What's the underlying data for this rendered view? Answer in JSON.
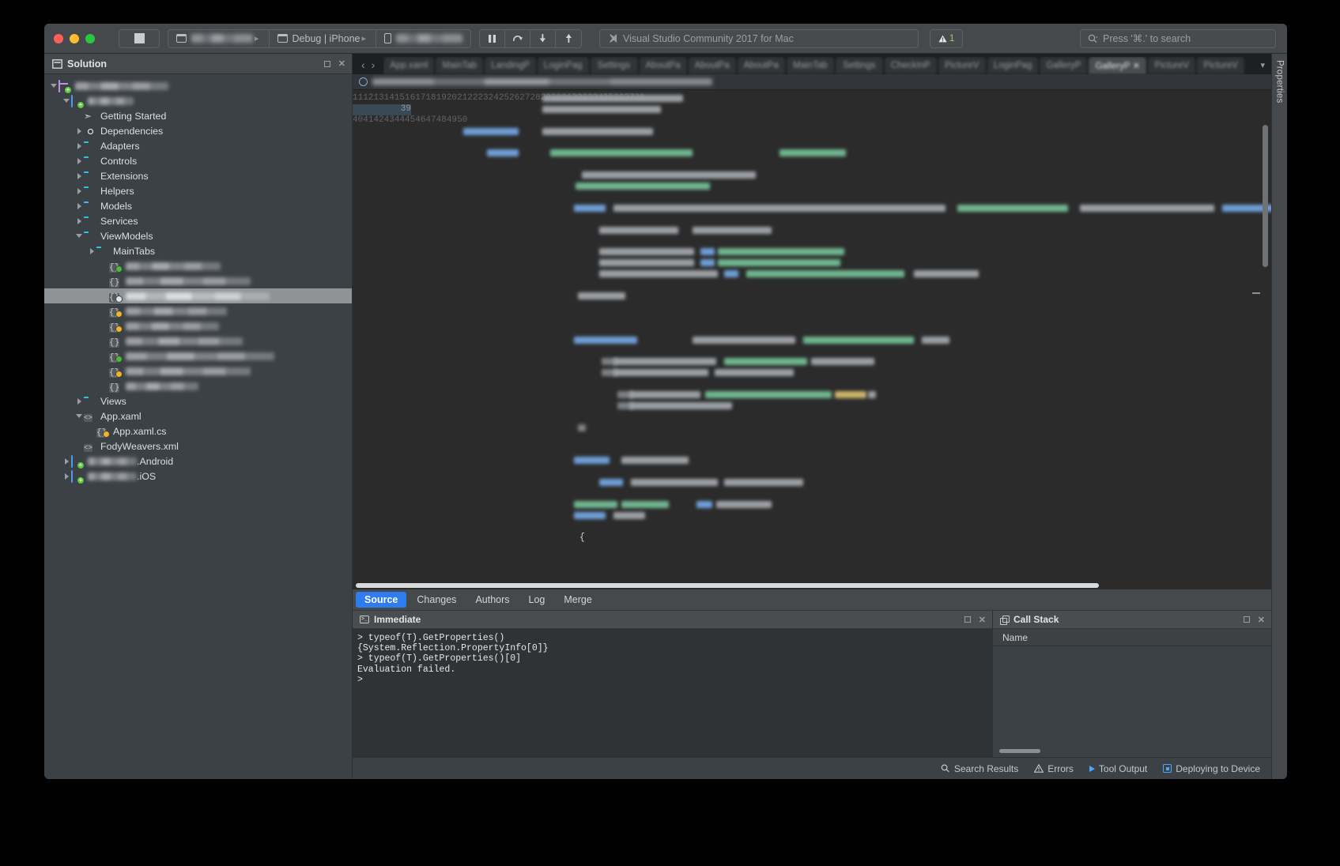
{
  "window": {
    "title": "Visual Studio Community 2017 for Mac",
    "traffic_lights": [
      "close",
      "minimize",
      "zoom"
    ]
  },
  "toolbar": {
    "run_button_label": "Stop",
    "config": {
      "project_name_redacted": "(redacted)",
      "configuration": "Debug | iPhone",
      "device_redacted": "(redacted device)"
    },
    "debug_buttons": [
      {
        "name": "pause",
        "glyph": "❚❚"
      },
      {
        "name": "step-over",
        "glyph": "↷"
      },
      {
        "name": "step-into",
        "glyph": "↓"
      },
      {
        "name": "step-out",
        "glyph": "↑"
      }
    ],
    "status_title": "Visual Studio Community 2017 for Mac",
    "warning_count": "1",
    "search_placeholder": "Press '⌘.' to search",
    "search_value": ""
  },
  "solution_pad": {
    "title": "Solution",
    "buttons": [
      "maximize",
      "close"
    ],
    "tree": [
      {
        "label": "",
        "redacted": true,
        "redacted_width": 118,
        "indent": 0,
        "icon": "solution-icon",
        "twisty": "open",
        "badge": "plus"
      },
      {
        "label": "",
        "redacted": true,
        "redacted_width": 58,
        "indent": 1,
        "icon": "project-icon",
        "twisty": "open",
        "badge": "plus"
      },
      {
        "label": "Getting Started",
        "indent": 2,
        "icon": "rocket-icon",
        "twisty": "none"
      },
      {
        "label": "Dependencies",
        "indent": 2,
        "icon": "dependencies-icon",
        "twisty": "closed"
      },
      {
        "label": "Adapters",
        "indent": 2,
        "icon": "folder-icon",
        "twisty": "closed"
      },
      {
        "label": "Controls",
        "indent": 2,
        "icon": "folder-icon",
        "twisty": "closed"
      },
      {
        "label": "Extensions",
        "indent": 2,
        "icon": "folder-icon",
        "twisty": "closed"
      },
      {
        "label": "Helpers",
        "indent": 2,
        "icon": "folder-icon",
        "twisty": "closed"
      },
      {
        "label": "Models",
        "indent": 2,
        "icon": "folder-icon",
        "twisty": "closed"
      },
      {
        "label": "Services",
        "indent": 2,
        "icon": "folder-icon",
        "twisty": "closed"
      },
      {
        "label": "ViewModels",
        "indent": 2,
        "icon": "folder-icon",
        "twisty": "open"
      },
      {
        "label": "MainTabs",
        "indent": 3,
        "icon": "folder-icon",
        "twisty": "closed"
      },
      {
        "label": "",
        "redacted": true,
        "redacted_width": 120,
        "indent": 4,
        "icon": "csharp-file-icon",
        "twisty": "none",
        "badge": "green"
      },
      {
        "label": "",
        "redacted": true,
        "redacted_width": 158,
        "indent": 4,
        "icon": "csharp-file-icon",
        "twisty": "none"
      },
      {
        "label": "",
        "redacted": true,
        "redacted_width": 182,
        "indent": 4,
        "icon": "csharp-file-icon",
        "twisty": "none",
        "badge": "blue",
        "selected": true
      },
      {
        "label": "",
        "redacted": true,
        "redacted_width": 128,
        "indent": 4,
        "icon": "csharp-file-icon",
        "twisty": "none",
        "badge": "orange"
      },
      {
        "label": "",
        "redacted": true,
        "redacted_width": 118,
        "indent": 4,
        "icon": "csharp-file-icon",
        "twisty": "none",
        "badge": "orange"
      },
      {
        "label": "",
        "redacted": true,
        "redacted_width": 148,
        "indent": 4,
        "icon": "csharp-file-icon",
        "twisty": "none"
      },
      {
        "label": "",
        "redacted": true,
        "redacted_width": 188,
        "indent": 4,
        "icon": "csharp-file-icon",
        "twisty": "none",
        "badge": "green"
      },
      {
        "label": "",
        "redacted": true,
        "redacted_width": 158,
        "indent": 4,
        "icon": "csharp-file-icon",
        "twisty": "none",
        "badge": "orange"
      },
      {
        "label": "",
        "redacted": true,
        "redacted_width": 92,
        "indent": 4,
        "icon": "csharp-file-icon",
        "twisty": "none"
      },
      {
        "label": "Views",
        "indent": 2,
        "icon": "folder-icon",
        "twisty": "closed"
      },
      {
        "label": "App.xaml",
        "indent": 2,
        "icon": "xml-file-icon",
        "twisty": "open"
      },
      {
        "label": "App.xaml.cs",
        "indent": 3,
        "icon": "csharp-file-icon",
        "twisty": "none",
        "badge": "orange"
      },
      {
        "label": "FodyWeavers.xml",
        "indent": 2,
        "icon": "xml-file-icon",
        "twisty": "none"
      },
      {
        "label": ".Android",
        "redacted_prefix": true,
        "redacted_width": 62,
        "indent": 1,
        "icon": "project-icon",
        "twisty": "closed",
        "badge": "plus"
      },
      {
        "label": ".iOS",
        "redacted_prefix": true,
        "redacted_width": 62,
        "indent": 1,
        "icon": "project-icon",
        "twisty": "closed",
        "badge": "plus"
      }
    ]
  },
  "editor": {
    "nav_back": "‹",
    "nav_forward": "›",
    "tabs": [
      {
        "label": "App.xaml",
        "active": false
      },
      {
        "label": "MainTab",
        "active": false
      },
      {
        "label": "LandingP",
        "active": false
      },
      {
        "label": "LoginPag",
        "active": false
      },
      {
        "label": "Settings",
        "active": false
      },
      {
        "label": "AboutPa",
        "active": false
      },
      {
        "label": "AboutPa",
        "active": false
      },
      {
        "label": "AboutPa",
        "active": false
      },
      {
        "label": "MainTab",
        "active": false
      },
      {
        "label": "Settings",
        "active": false
      },
      {
        "label": "CheckInP",
        "active": false
      },
      {
        "label": "PictureV",
        "active": false
      },
      {
        "label": "LoginPag",
        "active": false
      },
      {
        "label": "GalleryP",
        "active": false
      },
      {
        "label": "GalleryP",
        "active": true
      },
      {
        "label": "PictureV",
        "active": false
      },
      {
        "label": "PictureV",
        "active": false
      }
    ],
    "tab_overflow": "▾",
    "line_numbers": [
      "11",
      "12",
      "13",
      "14",
      "15",
      "16",
      "17",
      "18",
      "19",
      "20",
      "21",
      "22",
      "23",
      "24",
      "25",
      "26",
      "27",
      "28",
      "29",
      "30",
      "31",
      "32",
      "33",
      "34",
      "35",
      "36",
      "37",
      "38",
      "39",
      "40",
      "41",
      "42",
      "43",
      "44",
      "45",
      "46",
      "47",
      "48",
      "49",
      "50"
    ],
    "highlighted_line": "39",
    "last_line_text": "{"
  },
  "bottom_pad": {
    "tabs": [
      {
        "label": "Source",
        "active": true
      },
      {
        "label": "Changes",
        "active": false
      },
      {
        "label": "Authors",
        "active": false
      },
      {
        "label": "Log",
        "active": false
      },
      {
        "label": "Merge",
        "active": false
      }
    ],
    "immediate": {
      "title": "Immediate",
      "buttons": [
        "maximize",
        "close"
      ],
      "output": "> typeof(T).GetProperties()\n{System.Reflection.PropertyInfo[0]}\n> typeof(T).GetProperties()[0]\nEvaluation failed.\n>"
    },
    "call_stack": {
      "title": "Call Stack",
      "buttons": [
        "maximize",
        "close"
      ],
      "columns": [
        "Name"
      ],
      "rows": []
    }
  },
  "status_bar": {
    "items": [
      {
        "label": "Search Results",
        "icon": "search-icon"
      },
      {
        "label": "Errors",
        "icon": "warning-icon"
      },
      {
        "label": "Tool Output",
        "icon": "play-icon"
      },
      {
        "label": "Deploying to Device",
        "icon": "device-icon"
      }
    ]
  },
  "right_pad": {
    "label": "Properties"
  },
  "colors": {
    "accent_blue": "#2f7bf0",
    "folder_cyan": "#2ec2f0",
    "project_blue": "#4a9bea",
    "solution_purple": "#c08fe8",
    "badge_green": "#5cc93f",
    "badge_orange": "#f0b429",
    "status_blue": "#4ca6ff",
    "warning_green": "#9ccf6b",
    "window_chrome": "#46494c",
    "pad_bg": "#3c4145",
    "editor_bg": "#2b2b2b"
  }
}
